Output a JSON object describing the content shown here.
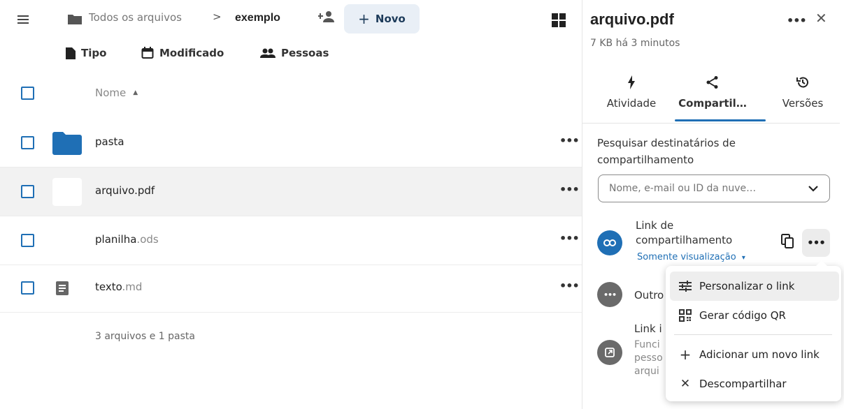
{
  "header": {
    "breadcrumb_home": "Todos os arquivos",
    "breadcrumb_sep": ">",
    "breadcrumb_current": "exemplo",
    "new_button_label": "Novo"
  },
  "filters": {
    "type_label": "Tipo",
    "modified_label": "Modificado",
    "people_label": "Pessoas"
  },
  "list": {
    "name_header": "Nome",
    "rows": [
      {
        "name": "pasta",
        "ext": "",
        "icon": "folder-icon"
      },
      {
        "name": "arquivo",
        "ext": ".pdf",
        "icon": "pdf-thumbnail"
      },
      {
        "name": "planilha",
        "ext": ".ods",
        "icon": "spreadsheet-icon"
      },
      {
        "name": "texto",
        "ext": ".md",
        "icon": "text-file-icon"
      }
    ],
    "summary": "3 arquivos e 1 pasta"
  },
  "sidebar": {
    "title": "arquivo.pdf",
    "subtitle": "7 KB há 3 minutos",
    "tabs": [
      {
        "label": "Atividade",
        "icon": "bolt-icon"
      },
      {
        "label": "Compartil…",
        "icon": "share-icon"
      },
      {
        "label": "Versões",
        "icon": "history-icon"
      }
    ],
    "search_label": "Pesquisar destinatários de compartilhamento",
    "search_placeholder": "Nome, e-mail ou ID da nuve…",
    "share_link_title": "Link de compartilhamento",
    "share_link_permission": "Somente visualização",
    "share_link_permission_caret": "▾",
    "others_label": "Outro",
    "internal_label": "Link i",
    "internal_desc": "Funci pesso arqui"
  },
  "menu": {
    "items": [
      {
        "label": "Personalizar o link",
        "icon": "tune-icon"
      },
      {
        "label": "Gerar código QR",
        "icon": "qrcode-icon"
      },
      {
        "label": "Adicionar um novo link",
        "icon": "plus-icon"
      },
      {
        "label": "Descompartilhar",
        "icon": "close-icon"
      }
    ]
  },
  "colors": {
    "accent": "#1f6fb5",
    "folder": "#1f6fb5",
    "selected_row": "#f2f2f2"
  }
}
